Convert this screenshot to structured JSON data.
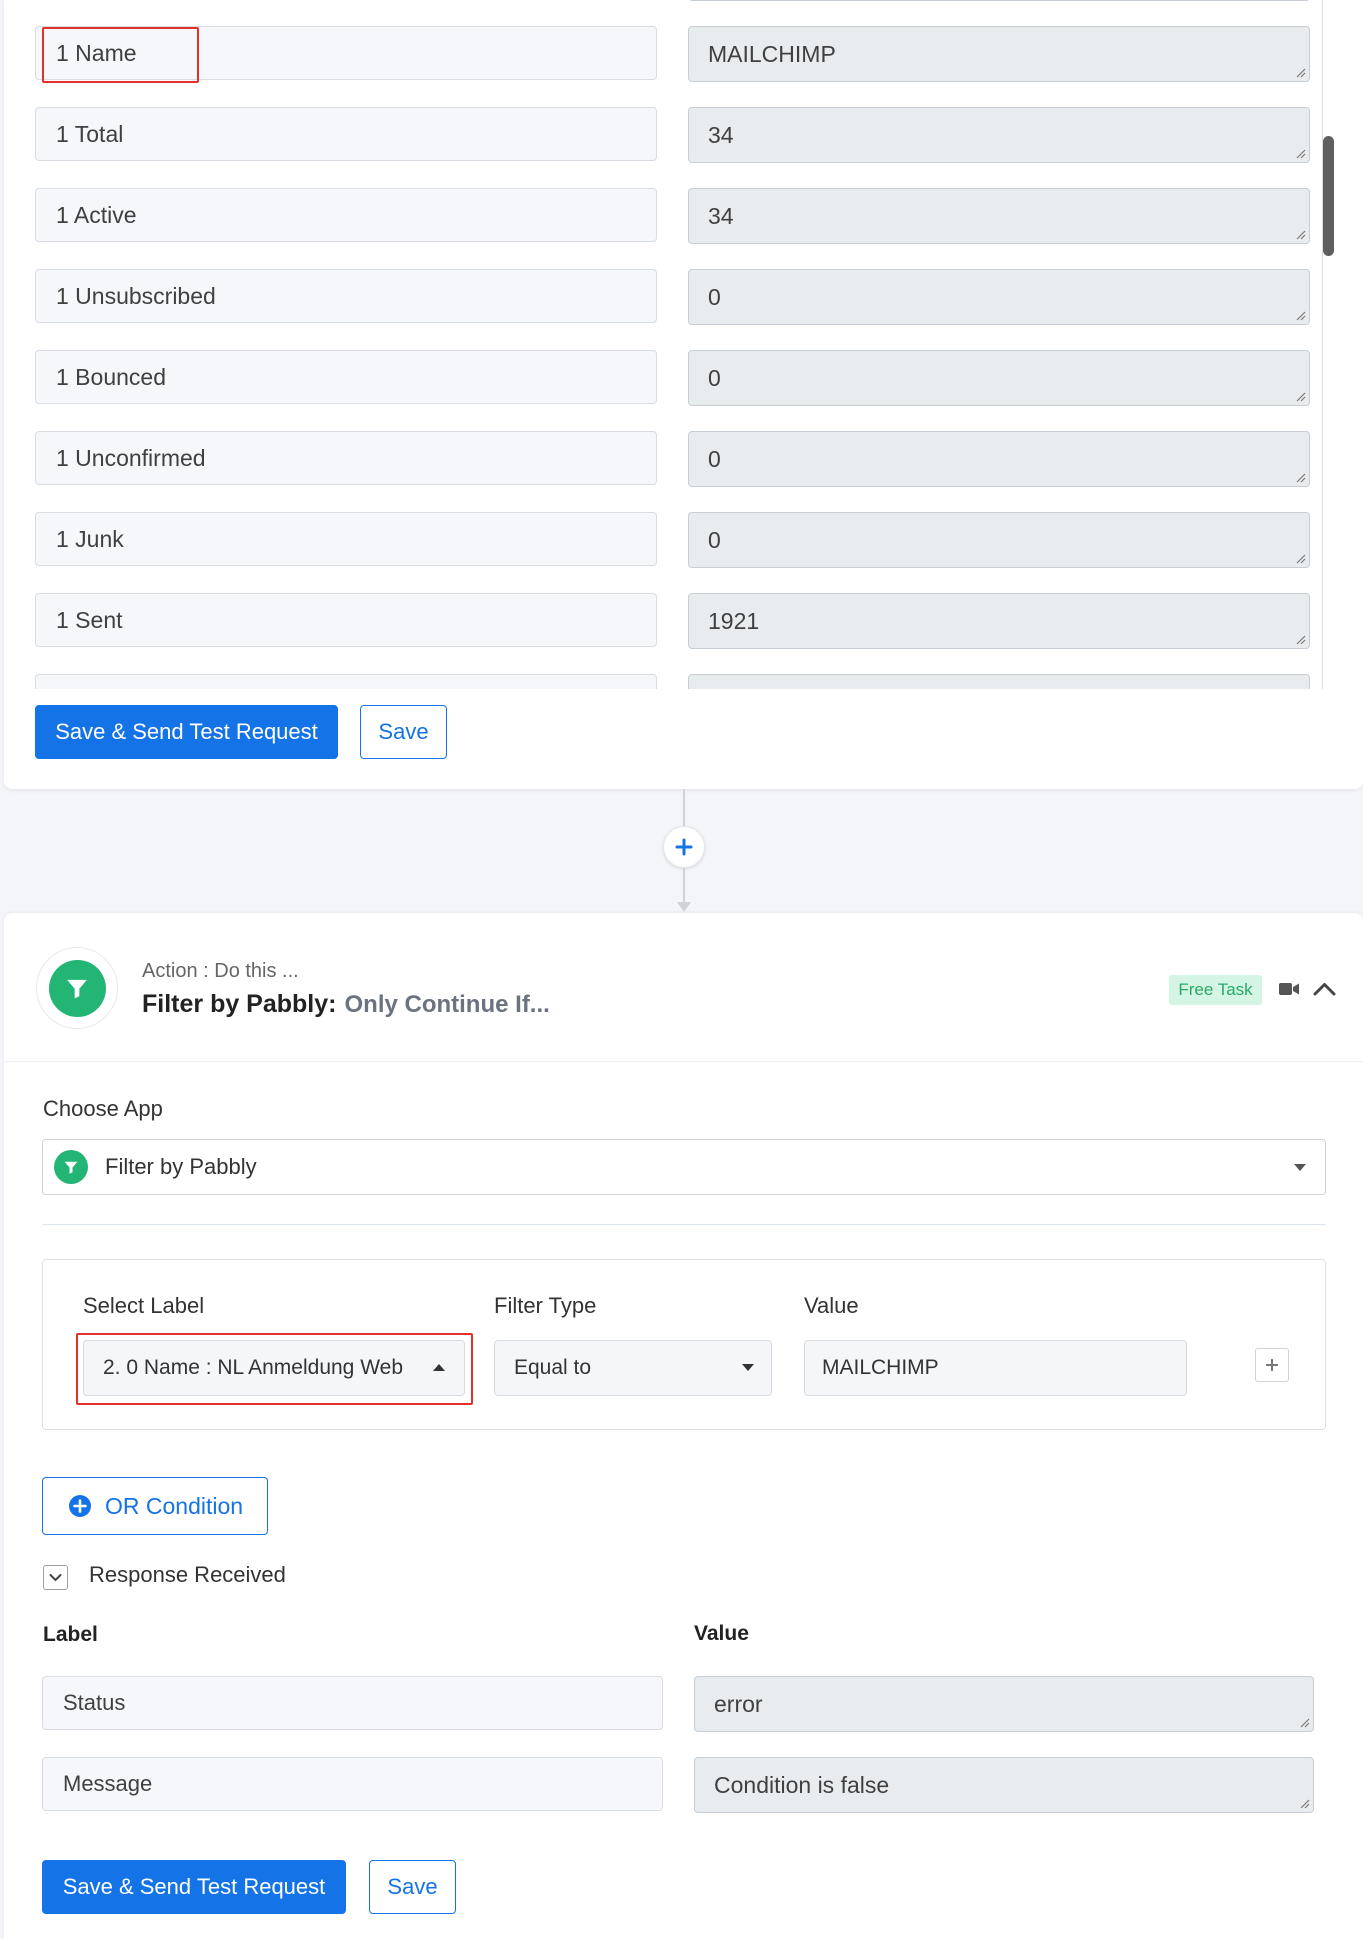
{
  "top_section": {
    "rows": [
      {
        "label": "1 Name",
        "value": "MAILCHIMP"
      },
      {
        "label": "1 Total",
        "value": "34"
      },
      {
        "label": "1 Active",
        "value": "34"
      },
      {
        "label": "1 Unsubscribed",
        "value": "0"
      },
      {
        "label": "1 Bounced",
        "value": "0"
      },
      {
        "label": "1 Unconfirmed",
        "value": "0"
      },
      {
        "label": "1 Junk",
        "value": "0"
      },
      {
        "label": "1 Sent",
        "value": "1921"
      }
    ],
    "save_send_button": "Save & Send Test Request",
    "save_button": "Save"
  },
  "connector": {
    "icon": "plus-icon"
  },
  "action_step": {
    "caption": "Action : Do this ...",
    "app_title": "Filter by Pabbly:",
    "event_title": "Only Continue If...",
    "badge": "Free Task",
    "app_icon": "funnel-icon",
    "header_icons": [
      "video-camera-icon",
      "chevron-up-icon"
    ],
    "choose_app": {
      "label": "Choose App",
      "selected": "Filter by Pabbly",
      "icon": "funnel-icon"
    },
    "filter": {
      "headers": {
        "select_label": "Select Label",
        "filter_type": "Filter Type",
        "value": "Value"
      },
      "select_label": "2. 0 Name : NL Anmeldung Web",
      "filter_type": "Equal to",
      "value": "MAILCHIMP",
      "add_icon": "plus-icon"
    },
    "or_condition_button": "OR Condition",
    "response": {
      "toggle_label": "Response Received",
      "label_header": "Label",
      "value_header": "Value",
      "rows": [
        {
          "label": "Status",
          "value": "error"
        },
        {
          "label": "Message",
          "value": "Condition is false"
        }
      ]
    },
    "save_send_button": "Save & Send Test Request",
    "save_button": "Save"
  },
  "colors": {
    "primary": "#1473e6",
    "highlight": "#e0312b",
    "filter_green": "#22b573",
    "badge_bg": "#d5f5e4",
    "badge_text": "#2aa867",
    "page_bg": "#f3f5f8"
  }
}
